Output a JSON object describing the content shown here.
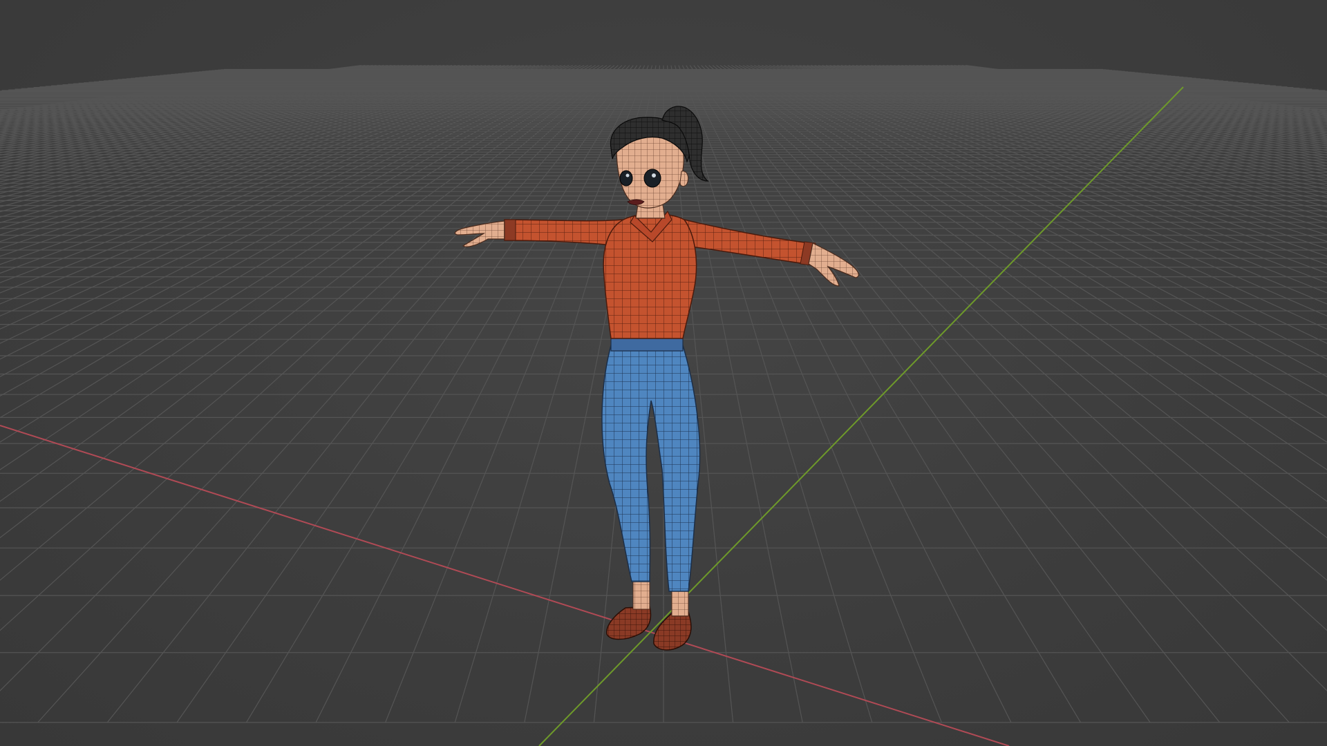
{
  "viewport": {
    "background_color": "#3d3d3d",
    "grid_color": "#555555",
    "x_axis_color": "#b04a55",
    "y_axis_color": "#6e9a2a"
  },
  "model": {
    "pose": "T-pose",
    "display": "wireframe-overlay",
    "shirt_color": "#c4532f",
    "jeans_color": "#4f86c0",
    "skin_color": "#e2ae8f",
    "hair_color": "#2a2a2a",
    "shoe_color": "#8a3a25",
    "waistband_color": "#3f6aa0"
  }
}
